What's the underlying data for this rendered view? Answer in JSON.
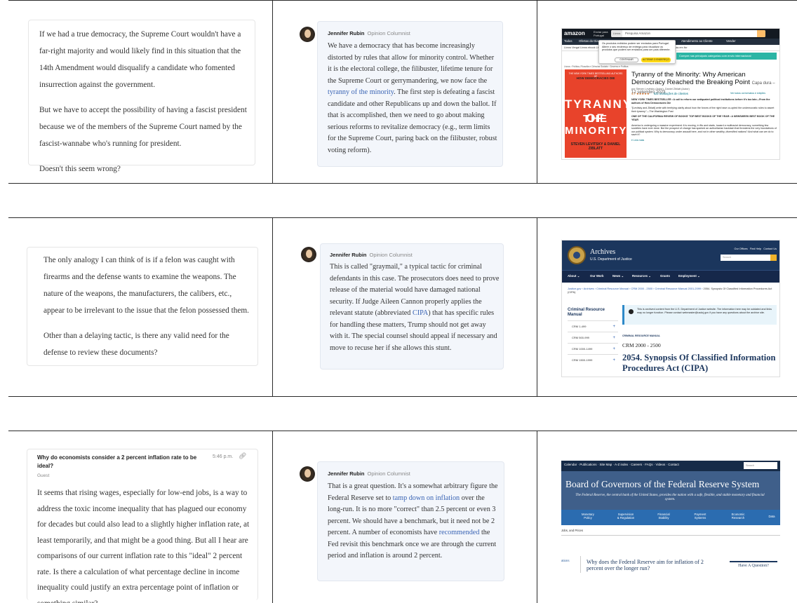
{
  "row1": {
    "question": {
      "p1": "If we had a true democracy, the Supreme Court wouldn't have a far-right majority and would likely find in this situation that the 14th Amendment would disqualify a candidate who fomented insurrection against the government.",
      "p2": "But we have to accept the possibility of having a fascist president because we of the members of the Supreme Court named by the fascist-wannabe who's running for president.",
      "p3": "Doesn't this seem wrong?"
    },
    "answer": {
      "author": "Jennifer Rubin",
      "role": "Opinion Columnist",
      "text_before": "We have a democracy that has become increasingly distorted by rules that allow for minority control. Whether it is the electoral college, the filibuster, lifetime tenure for the Supreme Court or gerrymandering, we now face the ",
      "link": "tyranny of the minority",
      "text_after": ". The first step is defeating a fascist candidate and other Republicans up and down the ballot. If that is accomplished, then we need to go about making serious reforms to revitalize democracy (e.g., term limits for the Supreme Court, paring back on the filibuster, robust voting reform)."
    },
    "amazon": {
      "logo": "amazon",
      "deliver": "Enviar para\nPortugal",
      "search_cat": "Livros",
      "search_placeholder": "Pesquisa Amazon",
      "nav": [
        "Todos",
        "Ofertas do Dia",
        "Atendimento ao Cliente",
        "Vender"
      ],
      "subnav": "Livros   Vergal   Livros ebook   Livros   Livros de bolso   Livros Infantis   Livros didáticos   Melhores ofertas em livr",
      "popup_text": "Os produtos exibidos podem ser enviados para Portugal. Altere o seu endereço de entrega para visualizar os produtos que podem ser enviados para um país diferente.",
      "popup_btn1": "CONTINUAR",
      "popup_btn2": "ALTERAR O ENDEREÇO",
      "banner": "Compre nas principais categorias com envio internacional",
      "breadcrumb": "Livros › Política, Filosofia e Ciências Sociais › Governo e Política",
      "book_top1": "THE NEW YORK TIMES BESTSELLING AUTHORS OF",
      "book_top2": "HOW DEMOCRACIES DIE",
      "book_t1": "TYRANNY OF",
      "book_t2": "THE MINORITY",
      "book_authors": "STEVEN LEVITSKY & DANIEL ZIBLATT",
      "title": "Tyranny of the Minority: Why American Democracy Reached the Breaking Point",
      "edition": "Capa dura – 12 setembro 2023",
      "by": "por Steven Levitsky (Autor), Daniel Ziblatt (Autor)",
      "rating": "4,7 ★★★★★",
      "reviews": "622 avaliações de clientes",
      "see_all": "Ver todos os formatos e edições",
      "d1": "NEW YORK TIMES BESTSELLER • A call to reform our antiquated political institutions before it's too late—From the authors of How Democracies Die",
      "d2": "\"[Levitsky and Ziblatt] write with terrifying clarity about how the forces of the right have co-opted the undemocratic rules to assert their tyranny.\"—The Washington Post",
      "d3": "ONE OF THE CALIFORNIA REVIEW OF BOOKS' TOP BEST BOOKS OF THE YEAR • A NEWSWEEK BEST BOOK OF THE YEAR",
      "d4": "America is undergoing a massive experiment: it is moving, in fits and starts, toward a multiracial democracy, something few societies have ever done. But the prospect of change has sparked an authoritarian backlash that threatens the very foundations of our political system. Why is democracy under assault here, and not in other wealthy, diversified nations? And what can we do to save it?",
      "read_more": "▾ Leia mais"
    }
  },
  "row2": {
    "question": {
      "p1": "The only analogy I can think of is if a felon was caught with firearms and the defense wants to examine the weapons. The nature of the weapons, the manufacturers, the calibers, etc., appear to be irrelevant to the issue that the felon possessed them.",
      "p2": "Other than a delaying tactic, is there any valid need for the defense to review these documents?"
    },
    "answer": {
      "author": "Jennifer Rubin",
      "role": "Opinion Columnist",
      "text_before": "This is called \"graymail,\" a typical tactic for criminal defendants in this case. The prosecutors does need to prove release of the material would have damaged national security. If Judge Aileen Cannon properly applies the relevant statute (abbreviated ",
      "link": "CIPA",
      "text_after": ") that has specific rules for handling these matters, Trump should not get away with it. The special counsel should appeal if necessary and move to recuse her if she allows this stunt."
    },
    "doj": {
      "title": "Archives",
      "subtitle": "U.S. Department of Justice",
      "top_links": "Our Offices   Find Help   Contact Us",
      "search_placeholder": "Search",
      "nav": [
        "About ⌄",
        "Our Work",
        "News ⌄",
        "Resources ⌄",
        "Grants",
        "Employment ⌄"
      ],
      "breadcrumb_links": "Justice.gov  ›  Archives  ›  Criminal Resource Manual  ›  CRM 2000 - 2500  ›  Criminal Resource Manual 2001-2099  ›",
      "breadcrumb_tail": "2054. Synopsis Of Classified Information Procedures Act (CIPA)",
      "side_title": "Criminal Resource Manual",
      "side_items": [
        "CRM 1-499",
        "CRM 500-999",
        "CRM 1000-1499",
        "CRM 1500-1999"
      ],
      "alert": "This is archived content from the U.S. Department of Justice website. The information here may be outdated and links may no longer function. Please contact webmaster@usdoj.gov if you have any questions about the archive site.",
      "crm_label": "CRIMINAL RESOURCE MANUAL",
      "crm_range": "CRM 2000 - 2500",
      "heading": "2054. Synopsis Of Classified Information Procedures Act (CIPA)"
    }
  },
  "row3": {
    "question": {
      "title": "Why do economists consider a 2 percent inflation rate to be ideal?",
      "time": "5:46 p.m.",
      "guest": "Guest",
      "p1": "It seems that rising wages, especially for low-end jobs, is a way to address the toxic income inequality that has plagued our economy for decades but could also lead to a slightly higher inflation rate, at least temporarily, and that might be a good thing. But all I hear are comparisons of our current inflation rate to this \"ideal\" 2 percent rate. Is there a calculation of what percentage decline in income inequality could justify an extra percentage point of inflation or something similar?"
    },
    "answer": {
      "author": "Jennifer Rubin",
      "role": "Opinion Columnist",
      "t1": "That is a great question. It's a somewhat arbitrary figure the Federal Reserve set to ",
      "link1": "tamp down on inflation",
      "t2": " over the long-run. It is no more \"correct\" than 2.5 percent or even 3 percent. We should have a benchmark, but it need not be 2 percent. A number of economists have ",
      "link2": "recommended",
      "t3": " the Fed revisit this benchmark once we are through the current period and inflation is around 2 percent."
    },
    "fed": {
      "top_links": "Calendar · Publications · Site Map · A-Z index · Careers · FAQs · Videos · Contact",
      "search": "Search",
      "title": "Board of Governors of the Federal Reserve System",
      "subtitle": "The Federal Reserve, the central bank of the United States, provides the nation with a safe, flexible, and stable monetary and financial system.",
      "nav": [
        "Monetary\nPolicy",
        "Supervision\n& Regulation",
        "Financial\nStability",
        "Payment\nSystems",
        "Economic\nResearch",
        "Data"
      ],
      "jobs": "Jobs, and Prices",
      "left_tab": "ations",
      "question": "Why does the Federal Reserve aim for inflation of 2 percent over the longer run?",
      "ask": "Have A Question?"
    }
  },
  "colors": {
    "link": "#3a64b4",
    "answer_bg": "#f3f6fb",
    "fed_blue": "#3f5f8a",
    "doj_navy": "#1b365d",
    "amazon_dark": "#131921"
  }
}
